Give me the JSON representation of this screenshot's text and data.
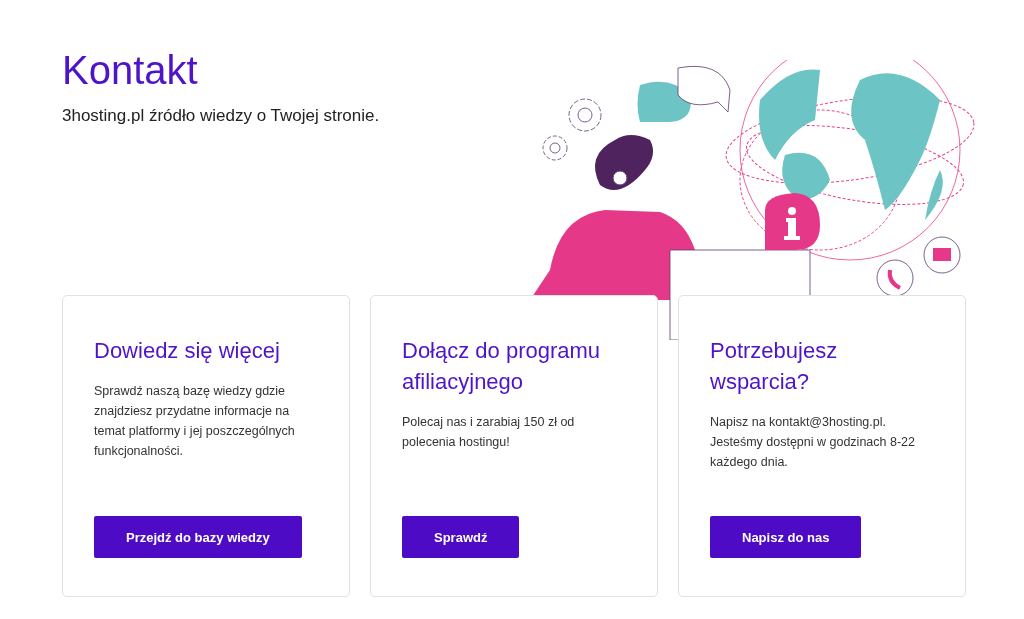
{
  "header": {
    "title": "Kontakt",
    "subtitle": "3hosting.pl źródło wiedzy o Twojej stronie."
  },
  "cards": [
    {
      "title": "Dowiedz się więcej",
      "text": "Sprawdź naszą bazę wiedzy gdzie znajdziesz przydatne informacje na temat platformy i jej poszczególnych funkcjonalności.",
      "button": "Przejdź do bazy wiedzy"
    },
    {
      "title": "Dołącz do programu afiliacyjnego",
      "text": "Polecaj nas i zarabiaj 150 zł od polecenia hostingu!",
      "button": "Sprawdź"
    },
    {
      "title": "Potrzebujesz wsparcia?",
      "text": "Napisz na kontakt@3hosting.pl. Jesteśmy dostępni w godzinach 8-22 każdego dnia.",
      "button": "Napisz do nas"
    }
  ]
}
